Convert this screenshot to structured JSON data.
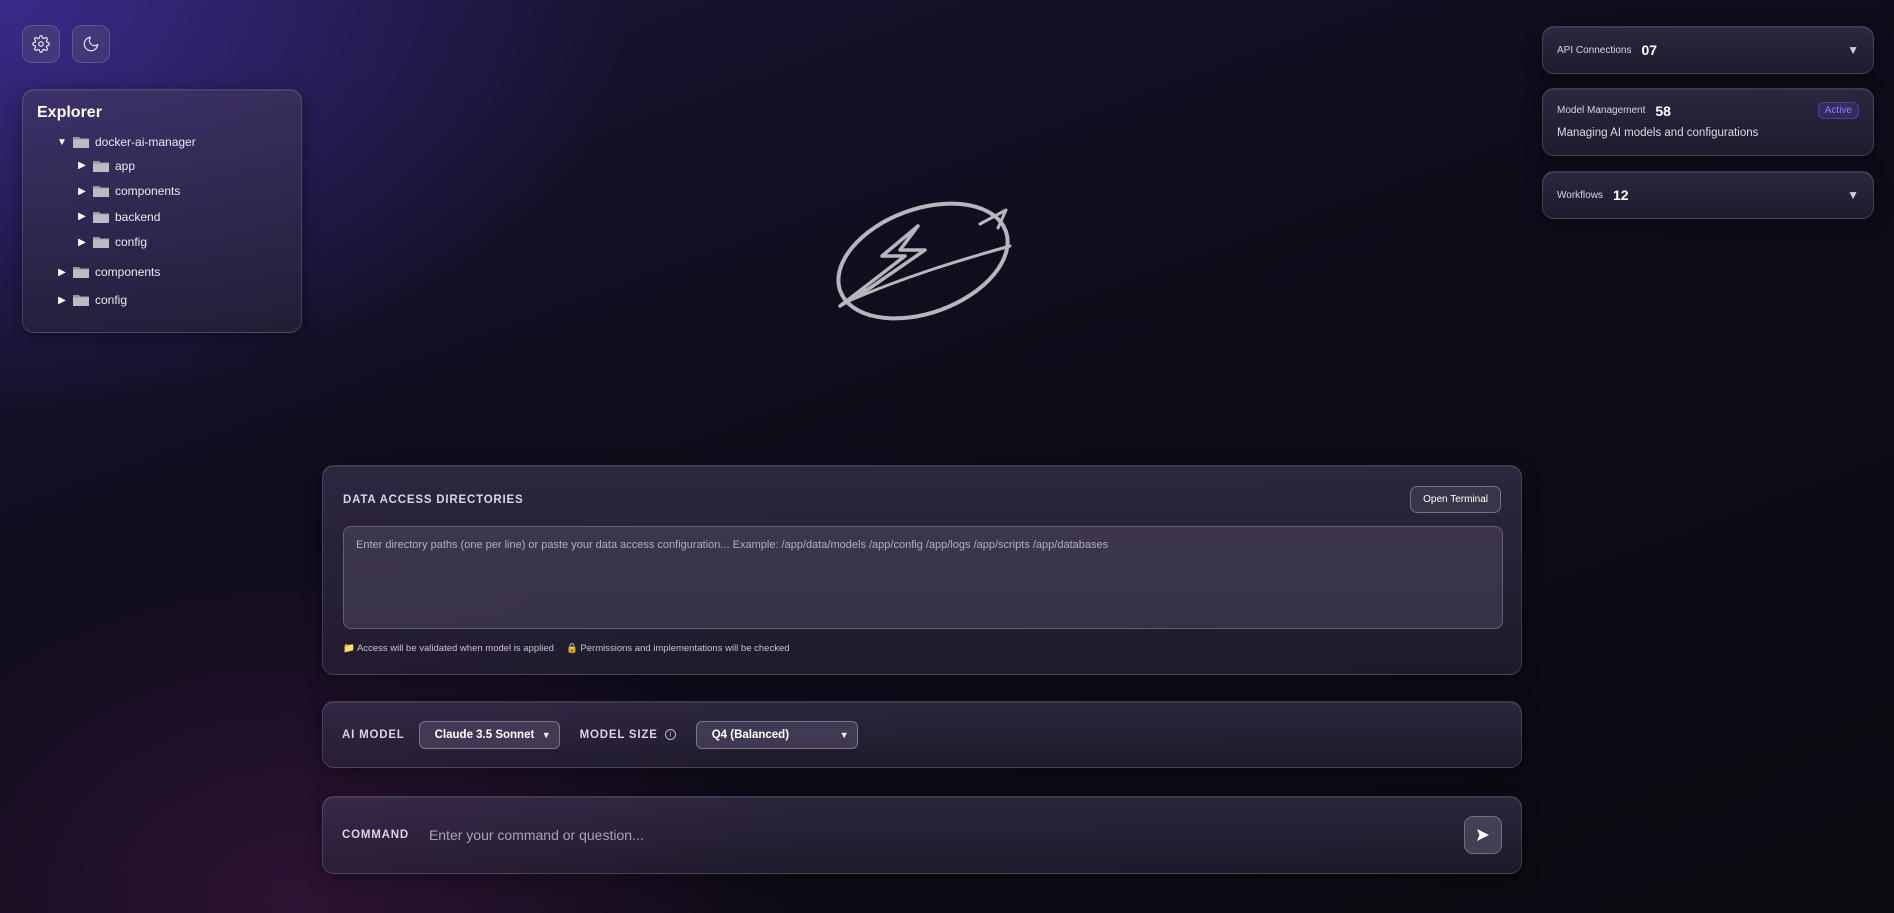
{
  "toolbar": {
    "settings_icon": "gear-icon",
    "theme_icon": "moon-icon"
  },
  "explorer": {
    "title": "Explorer",
    "root": {
      "name": "docker-ai-manager",
      "expanded": true,
      "children": [
        "app",
        "components",
        "backend",
        "config"
      ]
    },
    "siblings": [
      "components",
      "config"
    ]
  },
  "right_cards": {
    "api_connections": {
      "label": "API Connections",
      "count": "07"
    },
    "model_management": {
      "label": "Model Management",
      "count": "58",
      "badge": "Active",
      "description": "Managing AI models and configurations"
    },
    "workflows": {
      "label": "Workflows",
      "count": "12"
    }
  },
  "data_access": {
    "title": "DATA ACCESS DIRECTORIES",
    "open_terminal": "Open Terminal",
    "placeholder": "Enter directory paths (one per line) or paste your data access configuration... Example: /app/data/models /app/config /app/logs /app/scripts /app/databases",
    "hint_1": "Access will be validated when model is applied",
    "hint_2": "Permissions and implementations will be checked"
  },
  "model": {
    "ai_model_label": "AI MODEL",
    "ai_model_value": "Claude 3.5 Sonnet",
    "size_label": "MODEL SIZE",
    "size_value": "Q4 (Balanced)"
  },
  "command": {
    "label": "COMMAND",
    "placeholder": "Enter your command or question..."
  },
  "colors": {
    "accent": "#8c7dff",
    "background_top": "#3a2a8a",
    "background_bottom": "#0b0a10"
  }
}
